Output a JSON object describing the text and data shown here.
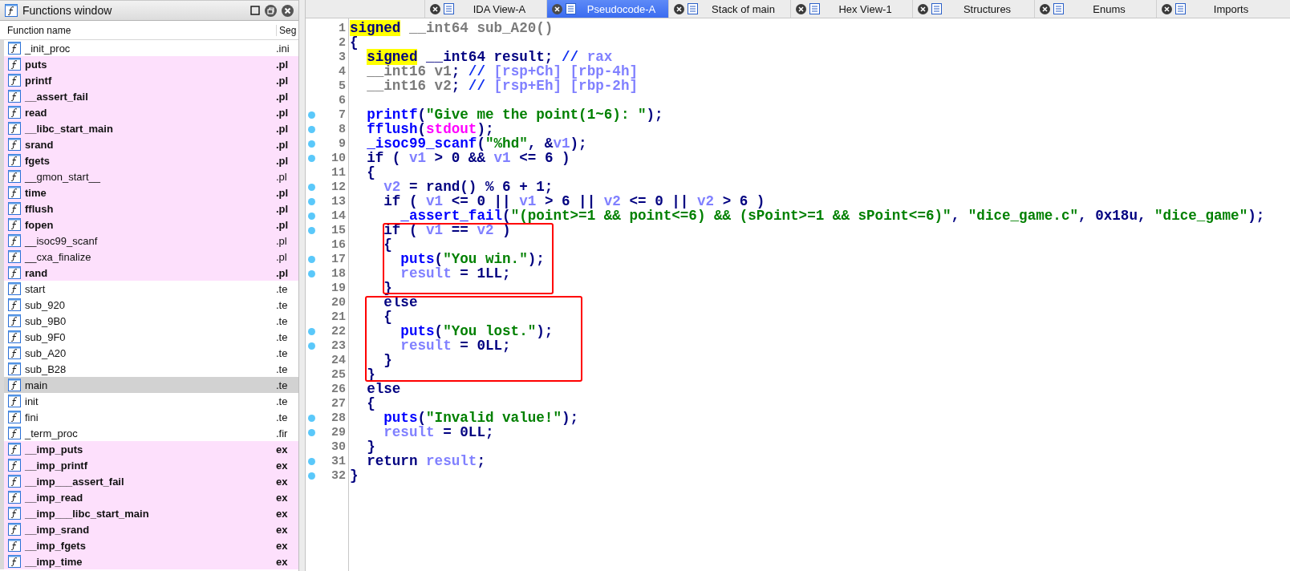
{
  "functions_window": {
    "title": "Functions window",
    "columns": [
      "Function name",
      "Seg"
    ],
    "rows": [
      {
        "name": "_init_proc",
        "segment": ".ini",
        "highlighted": false,
        "bold": false,
        "selected": false
      },
      {
        "name": "puts",
        "segment": ".pl",
        "highlighted": true,
        "bold": true,
        "selected": false
      },
      {
        "name": "printf",
        "segment": ".pl",
        "highlighted": true,
        "bold": true,
        "selected": false
      },
      {
        "name": "__assert_fail",
        "segment": ".pl",
        "highlighted": true,
        "bold": true,
        "selected": false
      },
      {
        "name": "read",
        "segment": ".pl",
        "highlighted": true,
        "bold": true,
        "selected": false
      },
      {
        "name": "__libc_start_main",
        "segment": ".pl",
        "highlighted": true,
        "bold": true,
        "selected": false
      },
      {
        "name": "srand",
        "segment": ".pl",
        "highlighted": true,
        "bold": true,
        "selected": false
      },
      {
        "name": "fgets",
        "segment": ".pl",
        "highlighted": true,
        "bold": true,
        "selected": false
      },
      {
        "name": "__gmon_start__",
        "segment": ".pl",
        "highlighted": true,
        "bold": false,
        "selected": false
      },
      {
        "name": "time",
        "segment": ".pl",
        "highlighted": true,
        "bold": true,
        "selected": false
      },
      {
        "name": "fflush",
        "segment": ".pl",
        "highlighted": true,
        "bold": true,
        "selected": false
      },
      {
        "name": "fopen",
        "segment": ".pl",
        "highlighted": true,
        "bold": true,
        "selected": false
      },
      {
        "name": "__isoc99_scanf",
        "segment": ".pl",
        "highlighted": true,
        "bold": false,
        "selected": false
      },
      {
        "name": "__cxa_finalize",
        "segment": ".pl",
        "highlighted": true,
        "bold": false,
        "selected": false
      },
      {
        "name": "rand",
        "segment": ".pl",
        "highlighted": true,
        "bold": true,
        "selected": false
      },
      {
        "name": "start",
        "segment": ".te",
        "highlighted": false,
        "bold": false,
        "selected": false
      },
      {
        "name": "sub_920",
        "segment": ".te",
        "highlighted": false,
        "bold": false,
        "selected": false
      },
      {
        "name": "sub_9B0",
        "segment": ".te",
        "highlighted": false,
        "bold": false,
        "selected": false
      },
      {
        "name": "sub_9F0",
        "segment": ".te",
        "highlighted": false,
        "bold": false,
        "selected": false
      },
      {
        "name": "sub_A20",
        "segment": ".te",
        "highlighted": false,
        "bold": false,
        "selected": false
      },
      {
        "name": "sub_B28",
        "segment": ".te",
        "highlighted": false,
        "bold": false,
        "selected": false
      },
      {
        "name": "main",
        "segment": ".te",
        "highlighted": false,
        "bold": false,
        "selected": true
      },
      {
        "name": "init",
        "segment": ".te",
        "highlighted": false,
        "bold": false,
        "selected": false
      },
      {
        "name": "fini",
        "segment": ".te",
        "highlighted": false,
        "bold": false,
        "selected": false
      },
      {
        "name": "_term_proc",
        "segment": ".fir",
        "highlighted": false,
        "bold": false,
        "selected": false
      },
      {
        "name": "__imp_puts",
        "segment": "ex",
        "highlighted": true,
        "bold": true,
        "selected": false
      },
      {
        "name": "__imp_printf",
        "segment": "ex",
        "highlighted": true,
        "bold": true,
        "selected": false
      },
      {
        "name": "__imp___assert_fail",
        "segment": "ex",
        "highlighted": true,
        "bold": true,
        "selected": false
      },
      {
        "name": "__imp_read",
        "segment": "ex",
        "highlighted": true,
        "bold": true,
        "selected": false
      },
      {
        "name": "__imp___libc_start_main",
        "segment": "ex",
        "highlighted": true,
        "bold": true,
        "selected": false
      },
      {
        "name": "__imp_srand",
        "segment": "ex",
        "highlighted": true,
        "bold": true,
        "selected": false
      },
      {
        "name": "__imp_fgets",
        "segment": "ex",
        "highlighted": true,
        "bold": true,
        "selected": false
      },
      {
        "name": "__imp_time",
        "segment": "ex",
        "highlighted": true,
        "bold": true,
        "selected": false
      }
    ]
  },
  "tabs": [
    {
      "label": "IDA View-A",
      "selected": false
    },
    {
      "label": "Pseudocode-A",
      "selected": true
    },
    {
      "label": "Stack of main",
      "selected": false
    },
    {
      "label": "Hex View-1",
      "selected": false
    },
    {
      "label": "Structures",
      "selected": false
    },
    {
      "label": "Enums",
      "selected": false
    },
    {
      "label": "Imports",
      "selected": false
    }
  ],
  "code": {
    "lines": [
      {
        "number": "1",
        "breakpoint": false,
        "tokens": [
          {
            "kind": "highlight",
            "text": "signed"
          },
          {
            "kind": "decl",
            "text": " __int64 sub_A20()"
          }
        ]
      },
      {
        "number": "2",
        "breakpoint": false,
        "tokens": [
          {
            "kind": "punct",
            "text": "{"
          }
        ]
      },
      {
        "number": "3",
        "breakpoint": false,
        "tokens": [
          {
            "kind": "highlight",
            "text": "  signed"
          },
          {
            "kind": "punct",
            "text": " __int64 result; "
          },
          {
            "kind": "comment",
            "text": "// "
          },
          {
            "kind": "var",
            "text": "rax"
          }
        ]
      },
      {
        "number": "4",
        "breakpoint": false,
        "tokens": [
          {
            "kind": "decl",
            "text": "  __int16 v1"
          },
          {
            "kind": "punct",
            "text": "; "
          },
          {
            "kind": "comment",
            "text": "// "
          },
          {
            "kind": "var",
            "text": "[rsp+Ch] [rbp-4h]"
          }
        ]
      },
      {
        "number": "5",
        "breakpoint": false,
        "tokens": [
          {
            "kind": "decl",
            "text": "  __int16 v2"
          },
          {
            "kind": "punct",
            "text": "; "
          },
          {
            "kind": "comment",
            "text": "// "
          },
          {
            "kind": "var",
            "text": "[rsp+Eh] [rbp-2h]"
          }
        ]
      },
      {
        "number": "6",
        "breakpoint": false
      },
      {
        "number": "7",
        "breakpoint": true,
        "tokens": [
          {
            "kind": "func",
            "text": "  printf"
          },
          {
            "kind": "punct",
            "text": "("
          },
          {
            "kind": "string",
            "text": "\"Give me the point(1~6): \""
          },
          {
            "kind": "punct",
            "text": ");"
          }
        ]
      },
      {
        "number": "8",
        "breakpoint": true,
        "tokens": [
          {
            "kind": "func",
            "text": "  fflush"
          },
          {
            "kind": "punct",
            "text": "("
          },
          {
            "kind": "macro",
            "text": "stdout"
          },
          {
            "kind": "punct",
            "text": ");"
          }
        ]
      },
      {
        "number": "9",
        "breakpoint": true,
        "tokens": [
          {
            "kind": "func",
            "text": "  _isoc99_scanf"
          },
          {
            "kind": "punct",
            "text": "("
          },
          {
            "kind": "string",
            "text": "\"%hd\""
          },
          {
            "kind": "punct",
            "text": ", &"
          },
          {
            "kind": "var",
            "text": "v1"
          },
          {
            "kind": "punct",
            "text": ");"
          }
        ]
      },
      {
        "number": "10",
        "breakpoint": true,
        "tokens": [
          {
            "kind": "punct",
            "text": "  if ( "
          },
          {
            "kind": "var",
            "text": "v1"
          },
          {
            "kind": "punct",
            "text": " > 0 && "
          },
          {
            "kind": "var",
            "text": "v1"
          },
          {
            "kind": "punct",
            "text": " <= 6 )"
          }
        ]
      },
      {
        "number": "11",
        "breakpoint": false,
        "tokens": [
          {
            "kind": "punct",
            "text": "  {"
          }
        ]
      },
      {
        "number": "12",
        "breakpoint": true,
        "tokens": [
          {
            "kind": "var",
            "text": "    v2"
          },
          {
            "kind": "punct",
            "text": " = rand() % 6 + 1;"
          }
        ]
      },
      {
        "number": "13",
        "breakpoint": true,
        "tokens": [
          {
            "kind": "punct",
            "text": "    if ( "
          },
          {
            "kind": "var",
            "text": "v1"
          },
          {
            "kind": "punct",
            "text": " <= 0 || "
          },
          {
            "kind": "var",
            "text": "v1"
          },
          {
            "kind": "punct",
            "text": " > 6 || "
          },
          {
            "kind": "var",
            "text": "v2"
          },
          {
            "kind": "punct",
            "text": " <= 0 || "
          },
          {
            "kind": "var",
            "text": "v2"
          },
          {
            "kind": "punct",
            "text": " > 6 )"
          }
        ]
      },
      {
        "number": "14",
        "breakpoint": true,
        "tokens": [
          {
            "kind": "func",
            "text": "      _assert_fail"
          },
          {
            "kind": "punct",
            "text": "("
          },
          {
            "kind": "string",
            "text": "\"(point>=1 && point<=6) && (sPoint>=1 && sPoint<=6)\""
          },
          {
            "kind": "punct",
            "text": ", "
          },
          {
            "kind": "string",
            "text": "\"dice_game.c\""
          },
          {
            "kind": "punct",
            "text": ", 0x18u, "
          },
          {
            "kind": "string",
            "text": "\"dice_game\""
          },
          {
            "kind": "punct",
            "text": ");"
          }
        ]
      },
      {
        "number": "15",
        "breakpoint": true,
        "tokens": [
          {
            "kind": "punct",
            "text": "    if ( "
          },
          {
            "kind": "var",
            "text": "v1"
          },
          {
            "kind": "punct",
            "text": " == "
          },
          {
            "kind": "var",
            "text": "v2"
          },
          {
            "kind": "punct",
            "text": " )"
          }
        ]
      },
      {
        "number": "16",
        "breakpoint": false,
        "tokens": [
          {
            "kind": "punct",
            "text": "    {"
          }
        ]
      },
      {
        "number": "17",
        "breakpoint": true,
        "tokens": [
          {
            "kind": "func",
            "text": "      puts"
          },
          {
            "kind": "punct",
            "text": "("
          },
          {
            "kind": "string",
            "text": "\"You win.\""
          },
          {
            "kind": "punct",
            "text": ");"
          }
        ]
      },
      {
        "number": "18",
        "breakpoint": true,
        "tokens": [
          {
            "kind": "var",
            "text": "      result"
          },
          {
            "kind": "punct",
            "text": " = 1LL;"
          }
        ]
      },
      {
        "number": "19",
        "breakpoint": false,
        "tokens": [
          {
            "kind": "punct",
            "text": "    }"
          }
        ]
      },
      {
        "number": "20",
        "breakpoint": false,
        "tokens": [
          {
            "kind": "punct",
            "text": "    else"
          }
        ]
      },
      {
        "number": "21",
        "breakpoint": false,
        "tokens": [
          {
            "kind": "punct",
            "text": "    {"
          }
        ]
      },
      {
        "number": "22",
        "breakpoint": true,
        "tokens": [
          {
            "kind": "func",
            "text": "      puts"
          },
          {
            "kind": "punct",
            "text": "("
          },
          {
            "kind": "string",
            "text": "\"You lost.\""
          },
          {
            "kind": "punct",
            "text": ");"
          }
        ]
      },
      {
        "number": "23",
        "breakpoint": true,
        "tokens": [
          {
            "kind": "var",
            "text": "      result"
          },
          {
            "kind": "punct",
            "text": " = 0LL;"
          }
        ]
      },
      {
        "number": "24",
        "breakpoint": false,
        "tokens": [
          {
            "kind": "punct",
            "text": "    }"
          }
        ]
      },
      {
        "number": "25",
        "breakpoint": false,
        "tokens": [
          {
            "kind": "punct",
            "text": "  }"
          }
        ]
      },
      {
        "number": "26",
        "breakpoint": false,
        "tokens": [
          {
            "kind": "punct",
            "text": "  else"
          }
        ]
      },
      {
        "number": "27",
        "breakpoint": false,
        "tokens": [
          {
            "kind": "punct",
            "text": "  {"
          }
        ]
      },
      {
        "number": "28",
        "breakpoint": true,
        "tokens": [
          {
            "kind": "func",
            "text": "    puts"
          },
          {
            "kind": "punct",
            "text": "("
          },
          {
            "kind": "string",
            "text": "\"Invalid value!\""
          },
          {
            "kind": "punct",
            "text": ");"
          }
        ]
      },
      {
        "number": "29",
        "breakpoint": true,
        "tokens": [
          {
            "kind": "var",
            "text": "    result"
          },
          {
            "kind": "punct",
            "text": " = 0LL;"
          }
        ]
      },
      {
        "number": "30",
        "breakpoint": false,
        "tokens": [
          {
            "kind": "punct",
            "text": "  }"
          }
        ]
      },
      {
        "number": "31",
        "breakpoint": true,
        "tokens": [
          {
            "kind": "punct",
            "text": "  return "
          },
          {
            "kind": "var",
            "text": "result"
          },
          {
            "kind": "punct",
            "text": ";"
          }
        ]
      },
      {
        "number": "32",
        "breakpoint": true,
        "tokens": [
          {
            "kind": "punct",
            "text": "}"
          }
        ]
      }
    ],
    "annotations": [
      {
        "kind": "frame"
      },
      {
        "kind": "frame"
      }
    ]
  }
}
